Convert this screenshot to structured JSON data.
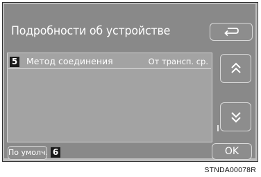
{
  "screen": {
    "title": "Подробности об устройстве",
    "back_icon": "return-arrow-icon",
    "row": {
      "badge": "5",
      "label": "Метод соединения",
      "value": "От трансп. ср."
    },
    "scroll_up_icon": "double-chevron-up-icon",
    "scroll_down_icon": "double-chevron-down-icon",
    "default_button": {
      "label": "По умолч.",
      "badge": "6"
    },
    "ok_button": "OK"
  },
  "figure_code": "STNDA00078R",
  "colors": {
    "screen_bg": "#898989",
    "panel_bg": "#a3a3a3",
    "text": "#ffffff",
    "badge_bg": "#1a1a1a"
  }
}
